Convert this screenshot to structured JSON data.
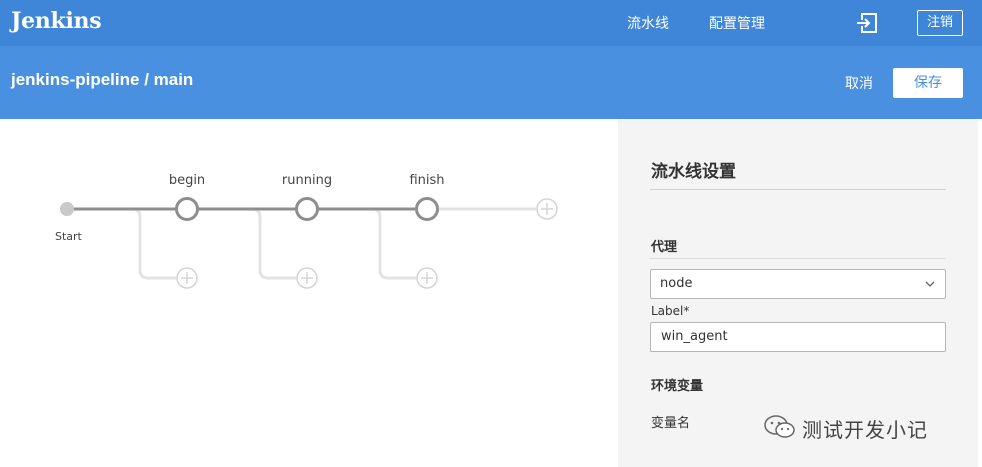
{
  "header": {
    "logo": "Jenkins",
    "nav": {
      "pipelines": "流水线",
      "admin": "配置管理"
    },
    "logout": "注销"
  },
  "subheader": {
    "title": "jenkins-pipeline / main",
    "cancel": "取消",
    "save": "保存"
  },
  "pipeline": {
    "start_label": "Start",
    "stages": [
      "begin",
      "running",
      "finish"
    ]
  },
  "settings": {
    "title": "流水线设置",
    "agent_section": "代理",
    "agent_value": "node",
    "label_caption": "Label*",
    "label_value": "win_agent",
    "env_section": "环境变量",
    "env_name_column": "变量名"
  },
  "watermark": {
    "text": "测试开发小记"
  },
  "colors": {
    "topbar": "#3f86d9",
    "subbar": "#4a90e0",
    "stage_node": "#8e8e8e",
    "panel_bg": "#f4f4f4"
  }
}
